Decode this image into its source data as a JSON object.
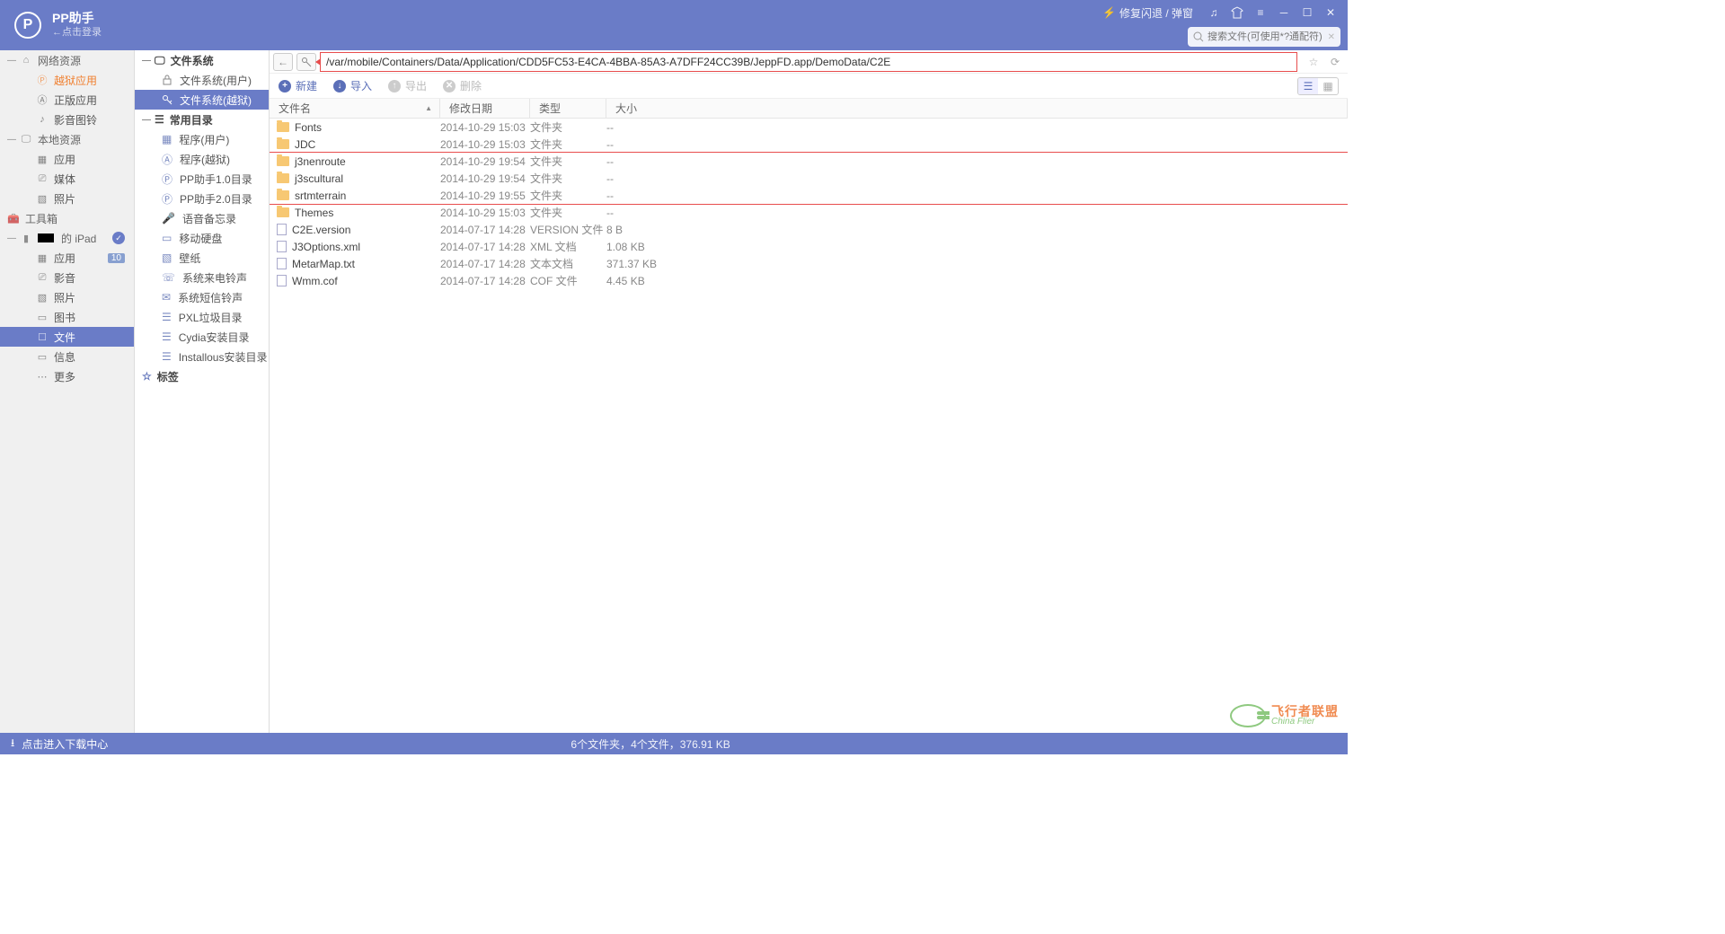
{
  "titlebar": {
    "app_name": "PP助手",
    "login_hint": "←点击登录",
    "repair_link": "修复闪退 / 弹窗",
    "search_placeholder": "搜索文件(可使用*?通配符)"
  },
  "sidebar1": {
    "network": {
      "title": "网络资源",
      "items": [
        {
          "label": "越狱应用",
          "icon": "p",
          "highlight": true
        },
        {
          "label": "正版应用",
          "icon": "a"
        },
        {
          "label": "影音图铃",
          "icon": "note"
        }
      ]
    },
    "local": {
      "title": "本地资源",
      "items": [
        {
          "label": "应用",
          "icon": "grid"
        },
        {
          "label": "媒体",
          "icon": "cam"
        },
        {
          "label": "照片",
          "icon": "pic"
        }
      ]
    },
    "toolbox": {
      "title": "工具箱"
    },
    "device": {
      "title": "的 iPad",
      "items": [
        {
          "label": "应用",
          "icon": "grid",
          "badge": "10"
        },
        {
          "label": "影音",
          "icon": "cam"
        },
        {
          "label": "照片",
          "icon": "pic"
        },
        {
          "label": "图书",
          "icon": "book"
        },
        {
          "label": "文件",
          "icon": "file",
          "selected": true
        },
        {
          "label": "信息",
          "icon": "chat"
        },
        {
          "label": "更多",
          "icon": "more"
        }
      ]
    }
  },
  "sidebar2": {
    "fs": {
      "title": "文件系统",
      "items": [
        {
          "label": "文件系统(用户)",
          "icon": "lock"
        },
        {
          "label": "文件系统(越狱)",
          "icon": "key",
          "selected": true
        }
      ]
    },
    "common": {
      "title": "常用目录",
      "items": [
        {
          "label": "程序(用户)",
          "icon": "grid"
        },
        {
          "label": "程序(越狱)",
          "icon": "a"
        },
        {
          "label": "PP助手1.0目录",
          "icon": "p"
        },
        {
          "label": "PP助手2.0目录",
          "icon": "p"
        },
        {
          "label": "语音备忘录",
          "icon": "mic"
        },
        {
          "label": "移动硬盘",
          "icon": "disk"
        },
        {
          "label": "壁纸",
          "icon": "pic"
        },
        {
          "label": "系统来电铃声",
          "icon": "phone"
        },
        {
          "label": "系统短信铃声",
          "icon": "msg"
        },
        {
          "label": "PXL垃圾目录",
          "icon": "trash"
        },
        {
          "label": "Cydia安装目录",
          "icon": "cydia"
        },
        {
          "label": "Installous安装目录",
          "icon": "inst"
        }
      ]
    },
    "bookmarks": {
      "title": "标签"
    }
  },
  "path": "/var/mobile/Containers/Data/Application/CDD5FC53-E4CA-4BBA-85A3-A7DFF24CC39B/JeppFD.app/DemoData/C2E",
  "toolbar": {
    "new": "新建",
    "import": "导入",
    "export": "导出",
    "delete": "删除"
  },
  "columns": {
    "name": "文件名",
    "date": "修改日期",
    "type": "类型",
    "size": "大小"
  },
  "files": [
    {
      "name": "Fonts",
      "date": "2014-10-29 15:03",
      "type": "文件夹",
      "size": "--",
      "kind": "folder"
    },
    {
      "name": "JDC",
      "date": "2014-10-29 15:03",
      "type": "文件夹",
      "size": "--",
      "kind": "folder"
    },
    {
      "name": "j3nenroute",
      "date": "2014-10-29 19:54",
      "type": "文件夹",
      "size": "--",
      "kind": "folder",
      "hl": true
    },
    {
      "name": "j3scultural",
      "date": "2014-10-29 19:54",
      "type": "文件夹",
      "size": "--",
      "kind": "folder",
      "hl": true
    },
    {
      "name": "srtmterrain",
      "date": "2014-10-29 19:55",
      "type": "文件夹",
      "size": "--",
      "kind": "folder",
      "hl": true
    },
    {
      "name": "Themes",
      "date": "2014-10-29 15:03",
      "type": "文件夹",
      "size": "--",
      "kind": "folder"
    },
    {
      "name": "C2E.version",
      "date": "2014-07-17 14:28",
      "type": "VERSION 文件",
      "size": "8 B",
      "kind": "file"
    },
    {
      "name": "J3Options.xml",
      "date": "2014-07-17 14:28",
      "type": "XML 文档",
      "size": "1.08 KB",
      "kind": "file"
    },
    {
      "name": "MetarMap.txt",
      "date": "2014-07-17 14:28",
      "type": "文本文档",
      "size": "371.37 KB",
      "kind": "file"
    },
    {
      "name": "Wmm.cof",
      "date": "2014-07-17 14:28",
      "type": "COF 文件",
      "size": "4.45 KB",
      "kind": "file"
    }
  ],
  "statusbar": {
    "download_center": "点击进入下载中心",
    "summary": "6个文件夹，4个文件，376.91 KB"
  },
  "watermark": {
    "cn": "飞行者联盟",
    "en": "China Flier"
  }
}
